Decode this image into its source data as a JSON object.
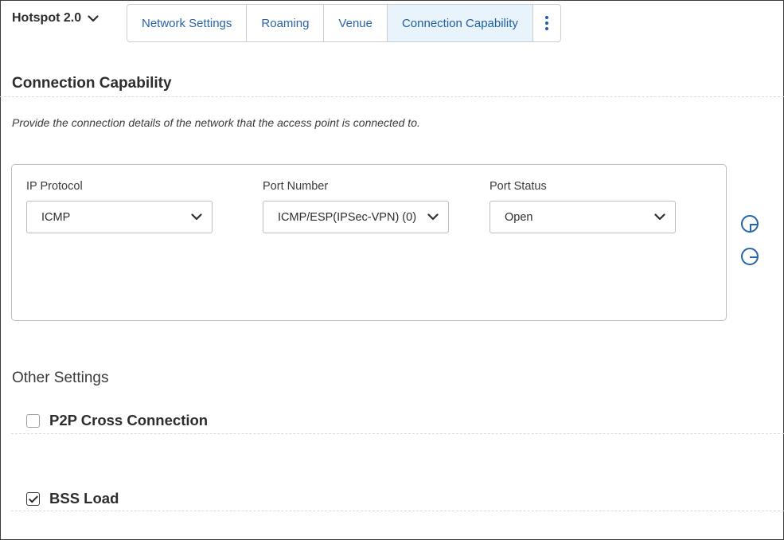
{
  "header": {
    "section_dropdown": {
      "label": "Hotspot 2.0"
    },
    "tabs": [
      {
        "label": "Network Settings",
        "active": false
      },
      {
        "label": "Roaming",
        "active": false
      },
      {
        "label": "Venue",
        "active": false
      },
      {
        "label": "Connection Capability",
        "active": true
      }
    ],
    "more_icon": "vertical-ellipsis-icon"
  },
  "connection_capability": {
    "title": "Connection Capability",
    "description": "Provide the connection details of the network that the access point is connected to.",
    "row": {
      "ip_protocol": {
        "label": "IP Protocol",
        "value": "ICMP"
      },
      "port_number": {
        "label": "Port Number",
        "value": "ICMP/ESP(IPSec-VPN) (0)"
      },
      "port_status": {
        "label": "Port Status",
        "value": "Open"
      }
    },
    "add_icon": "plus-circle-icon",
    "remove_icon": "minus-circle-icon"
  },
  "other_settings": {
    "title": "Other Settings",
    "p2p_cross_connection": {
      "label": "P2P Cross Connection",
      "checked": false
    },
    "bss_load": {
      "label": "BSS Load",
      "checked": true
    }
  },
  "colors": {
    "accent": "#2466a9",
    "tab_active_bg": "#e8f3fc",
    "border": "#b9bec3"
  }
}
